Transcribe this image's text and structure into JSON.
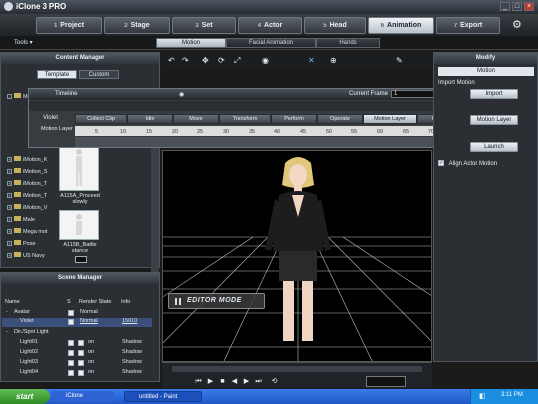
{
  "app": {
    "title": "iClone",
    "version": "3",
    "edition": "PRO"
  },
  "main_tabs": [
    {
      "num": "1",
      "label": "Project"
    },
    {
      "num": "2",
      "label": "Stage"
    },
    {
      "num": "3",
      "label": "Set"
    },
    {
      "num": "4",
      "label": "Actor"
    },
    {
      "num": "5",
      "label": "Head"
    },
    {
      "num": "6",
      "label": "Animation",
      "active": true
    },
    {
      "num": "7",
      "label": "Export"
    }
  ],
  "sub_tabs": [
    {
      "label": "Motion",
      "active": true
    },
    {
      "label": "Facial Animation"
    },
    {
      "label": "Hands"
    }
  ],
  "tools_label": "Tools",
  "content_manager": {
    "title": "Content Manager",
    "tabs": [
      {
        "label": "Template",
        "active": true
      },
      {
        "label": "Custom"
      }
    ],
    "tree": [
      "Motio",
      "iMotion_K",
      "iMotion_S",
      "iMotion_T",
      "iMotion_T",
      "iMotion_V",
      "Male",
      "Mega mot",
      "Pose",
      "US Navy"
    ],
    "items": [
      {
        "caption": "A115A_Proceed slowly"
      },
      {
        "caption": "A115B_Battle stance"
      }
    ]
  },
  "timeline": {
    "title": "Timeline",
    "current_frame_label": "Current Frame",
    "current_frame": "1",
    "actor": "Violet",
    "layer": "Motion Layer",
    "tracks": [
      "Collect Clip",
      "Idle",
      "Move",
      "Transform",
      "Perform",
      "Operate",
      "Motion Layer",
      "Hands"
    ],
    "active_track": "Motion Layer",
    "ruler": [
      "5",
      "10",
      "15",
      "20",
      "25",
      "30",
      "35",
      "40",
      "45",
      "50",
      "55",
      "60",
      "65",
      "70",
      "75"
    ]
  },
  "viewport": {
    "mode_label": "EDITOR MODE"
  },
  "modify": {
    "title": "Modify",
    "dropdown": "Motion",
    "import_label": "Import Motion",
    "import_button": "Import",
    "motion_layer_button": "Motion Layer",
    "launch_button": "Launch",
    "align_label": "Align Actor Motion",
    "align_checked": true
  },
  "scene_manager": {
    "title": "Scene Manager",
    "columns": [
      "Name",
      "S",
      "Render State",
      "Info"
    ],
    "rows": [
      {
        "name": "Avatar",
        "state": "Normal",
        "info": "",
        "expand": "-",
        "check": true
      },
      {
        "name": "Violet",
        "state": "Normal",
        "info": "15610",
        "selected": true,
        "check": true
      },
      {
        "name": "Dir./Spot Light",
        "state": "",
        "info": "",
        "expand": "-"
      },
      {
        "name": "Light01",
        "state": "on",
        "info": "Shadow",
        "check": true
      },
      {
        "name": "Light02",
        "state": "on",
        "info": "Shadow",
        "check": false
      },
      {
        "name": "Light03",
        "state": "on",
        "info": "Shadow",
        "check": false
      },
      {
        "name": "Light04",
        "state": "on",
        "info": "Shadow",
        "check": false
      }
    ]
  },
  "taskbar": {
    "start": "start",
    "tasks": [
      "iClone",
      "untitled - Paint"
    ],
    "clock": "3:11 PM"
  }
}
